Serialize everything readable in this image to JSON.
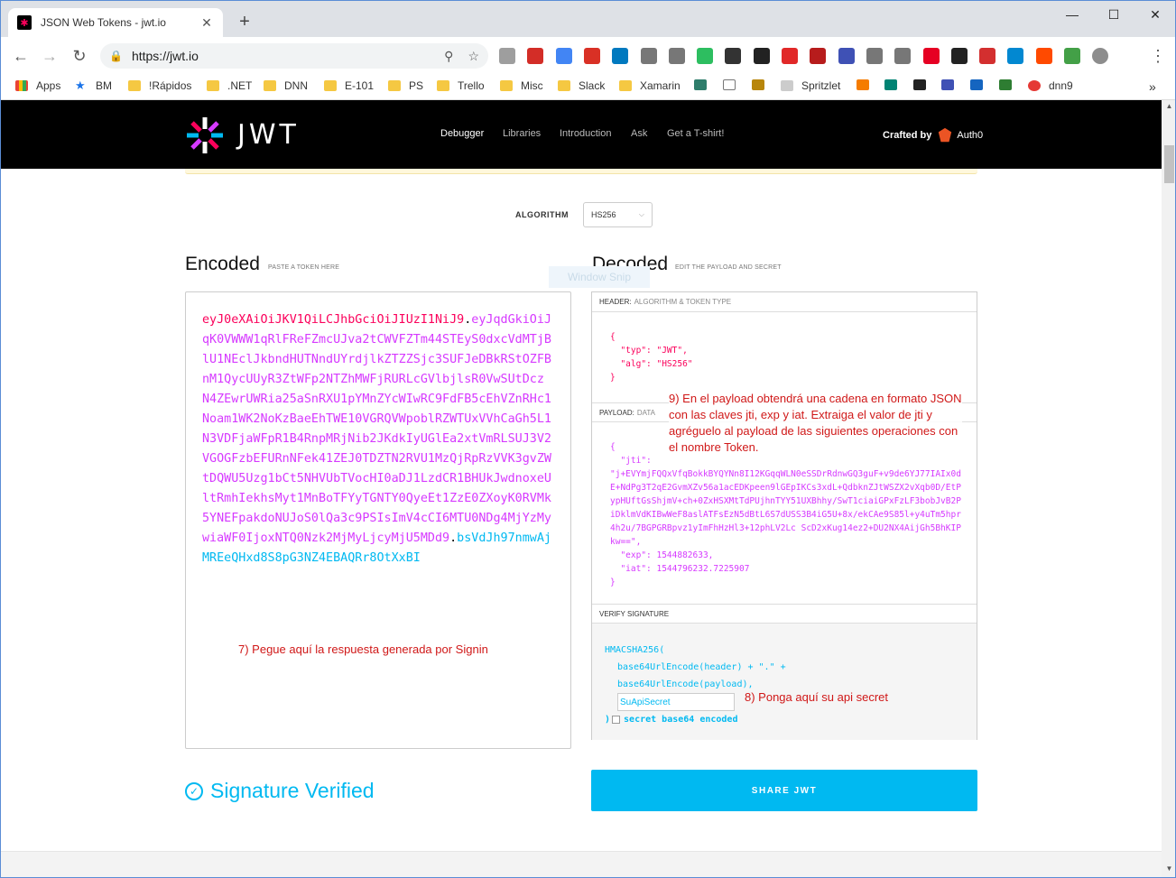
{
  "browser": {
    "tab_title": "JSON Web Tokens - jwt.io",
    "url": "https://jwt.io",
    "new_tab": "+",
    "window_controls": [
      "—",
      "☐",
      "✕"
    ],
    "extensions": [
      {
        "name": "reader-icon",
        "color": "#9e9e9e"
      },
      {
        "name": "lastpass-icon",
        "color": "#d32d27"
      },
      {
        "name": "translate-icon",
        "color": "#4285f4"
      },
      {
        "name": "calendar-icon",
        "color": "#d93025"
      },
      {
        "name": "trello-icon",
        "color": "#0079bf"
      },
      {
        "name": "bulb-icon",
        "color": "#777777"
      },
      {
        "name": "download-icon",
        "color": "#777777"
      },
      {
        "name": "evernote-icon",
        "color": "#2dbe60"
      },
      {
        "name": "mask-icon",
        "color": "#333333"
      },
      {
        "name": "colorzilla-icon",
        "color": "#222222"
      },
      {
        "name": "flipboard-icon",
        "color": "#e12828"
      },
      {
        "name": "speaker-icon",
        "color": "#b71c1c"
      },
      {
        "name": "search-ext-icon",
        "color": "#3f51b5"
      },
      {
        "name": "pen-icon",
        "color": "#777777"
      },
      {
        "name": "cloud-icon",
        "color": "#777777"
      },
      {
        "name": "pinterest-icon",
        "color": "#e60023"
      },
      {
        "name": "chrome-icon",
        "color": "#222222"
      },
      {
        "name": "clock-icon",
        "color": "#d32f2f"
      },
      {
        "name": "at-icon",
        "color": "#0288d1"
      },
      {
        "name": "zapier-icon",
        "color": "#ff4a00"
      },
      {
        "name": "r-icon",
        "color": "#43a047"
      },
      {
        "name": "profile-icon",
        "color": "#8d8d8d"
      }
    ],
    "bookmarks": [
      {
        "label": "Apps",
        "kind": "apps"
      },
      {
        "label": "BM",
        "kind": "star"
      },
      {
        "label": "!Rápidos",
        "kind": "folder"
      },
      {
        "label": ".NET",
        "kind": "folder"
      },
      {
        "label": "DNN",
        "kind": "folder"
      },
      {
        "label": "E-101",
        "kind": "folder"
      },
      {
        "label": "PS",
        "kind": "folder"
      },
      {
        "label": "Trello",
        "kind": "folder"
      },
      {
        "label": "Misc",
        "kind": "folder"
      },
      {
        "label": "Slack",
        "kind": "folder"
      },
      {
        "label": "Xamarin",
        "kind": "folder"
      },
      {
        "label": "Spritzlet",
        "kind": "site"
      },
      {
        "label": "dnn9",
        "kind": "site"
      }
    ],
    "more_bookmarks": "»"
  },
  "site": {
    "logo": "JWT",
    "nav": [
      "Debugger",
      "Libraries",
      "Introduction",
      "Ask",
      "Get a T-shirt!"
    ],
    "crafted_by": "Crafted by",
    "brand": "Auth0"
  },
  "algorithm": {
    "label": "ALGORITHM",
    "selected": "HS256"
  },
  "encoded": {
    "title": "Encoded",
    "subtitle": "PASTE A TOKEN HERE",
    "header_part": "eyJ0eXAiOiJKV1QiLCJhbGciOiJIUzI1NiJ9",
    "payload_part": "eyJqdGkiOiJqK0VWWW1qRlFReFZmcUJva2tCWVFZTm44STEyS0dxcVdMTjBlU1NEclJkbndHUTNndUYrdjlkZTZZSjc3SUFJeDBkRStOZFBnM1QycUUyR3ZtWFp2NTZhMWFjRURLcGVlbjlsR0VwSUtDcz N4ZEwrUWRia25aSnRXU1pYMnZYcWIwRC9FdFB5cEhVZnRHc1Noam1WK2NoKzBaeEhTWE10VGRQVWpoblRZWTUxVVhCaGh5L1N3VDFjaWFpR1B4RnpMRjNib2JKdkIyUGlEa2xtVmRLSUJ3V2VGOGFzbEFURnNFek41ZEJ0TDZTN2RVU1MzQjRpRzVVK3gvZWtDQWU5Uzg1bCt5NHVUbTVocHI0aDJ1LzdCR1BHUkJwdnoxeUltRmhIekhsMyt1MnBoTFYyTGNTY0QyeEt1ZzE0ZXoyK0RVMk5YNEFpakdoNUJoS0lQa3c9PSIsImV4cCI6MTU0NDg4MjYzMywiaWF0IjoxNTQ0Nzk2MjMyLjcyMjU5MDd9",
    "signature_part": "bsVdJh97nmwAjMREeQHxd8S8pG3NZ4EBAQRr8OtXxBI",
    "note": "7) Pegue aquí la respuesta generada por Signin"
  },
  "decoded": {
    "title": "Decoded",
    "subtitle": "EDIT THE PAYLOAD AND SECRET",
    "ghost": "Window Snip",
    "header": {
      "label": "HEADER:",
      "sublabel": "ALGORITHM & TOKEN TYPE",
      "lines": [
        "{",
        "  \"typ\": \"JWT\",",
        "  \"alg\": \"HS256\"",
        "}"
      ]
    },
    "payload": {
      "label": "PAYLOAD:",
      "sublabel": "DATA",
      "lines": [
        "{",
        "  \"jti\":",
        "\"j+EVYmjFQQxVfqBokkBYQYNn8I12KGqqWLN0eSSDrRdnwGQ3guF+v9de6YJ77IAIx0dE+NdPg3T2qE2GvmXZv56a1acEDKpeen9lGEpIKCs3xdL+QdbknZJtWSZX2vXqb0D/EtPypHUftGsShjmV+ch+0ZxHSXMtTdPUjhnTYY51UXBhhy/SwT1ciaiGPxFzLF3bobJvB2PiDklmVdKIBwWeF8aslATFsEzN5dBtL6S7dUSS3B4iG5U+8x/ekCAe9S85l+y4uTm5hpr4h2u/7BGPGRBpvz1yImFhHzHl3+12phLV2Lc ScD2xKug14ez2+DU2NX4AijGh5BhKIPkw==\",",
        "  \"exp\": 1544882633,",
        "  \"iat\": 1544796232.7225907",
        "}"
      ],
      "note": "9) En el payload obtendrá una cadena en formato JSON con las claves jti, exp y iat. Extraiga el valor de jti y agréguelo al payload de las siguientes operaciones con el nombre Token."
    },
    "signature": {
      "label": "VERIFY SIGNATURE",
      "fn_open": "HMACSHA256(",
      "line1": "base64UrlEncode(header) + \".\" +",
      "line2": "base64UrlEncode(payload),",
      "secret_value": "SuApiSecret",
      "close": ")",
      "checkbox_label": "secret base64 encoded",
      "note": "8) Ponga aquí su api secret"
    }
  },
  "status": {
    "verified": "Signature Verified",
    "check": "✓"
  },
  "share_button": "SHARE JWT",
  "colors": {
    "header": "#fb015b",
    "payload": "#d63aff",
    "signature": "#00b9f1",
    "note": "#d01818"
  }
}
